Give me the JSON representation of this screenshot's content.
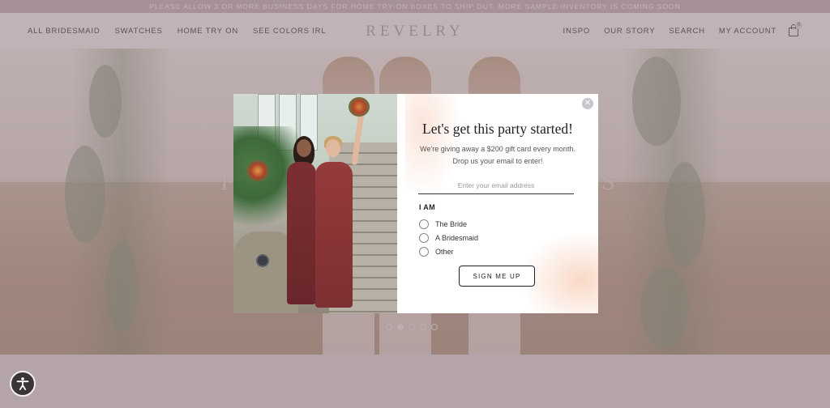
{
  "announcement": "PLEASE ALLOW 3 OR MORE BUSINESS DAYS FOR HOME TRY-ON BOXES TO SHIP OUT. MORE SAMPLE INVENTORY IS COMING SOON",
  "brand": {
    "logo": "REVELRY"
  },
  "nav_left": [
    "ALL BRIDESMAID",
    "SWATCHES",
    "HOME TRY ON",
    "SEE COLORS IRL"
  ],
  "nav_right": [
    "INSPO",
    "OUR STORY",
    "SEARCH",
    "MY ACCOUNT"
  ],
  "cart": {
    "icon": "shopping-bag-icon",
    "count": "0"
  },
  "hero": {
    "carousel_slides": 5,
    "active_slide": 2,
    "text_left": "F",
    "text_right": "S"
  },
  "modal": {
    "headline": "Let's get this party started!",
    "subline_1": "We're giving away a $200 gift card every month.",
    "subline_2": "Drop us your email to enter!",
    "email_placeholder": "Enter your email address",
    "role_label": "I AM",
    "options": [
      "The Bride",
      "A Bridesmaid",
      "Other"
    ],
    "submit_label": "SIGN ME UP",
    "close_glyph": "✕"
  },
  "accessibility": {
    "icon": "accessibility-icon"
  },
  "colors": {
    "overlay": "#78626c",
    "announce_bg": "#c9b4b8",
    "button_border": "#222222"
  }
}
